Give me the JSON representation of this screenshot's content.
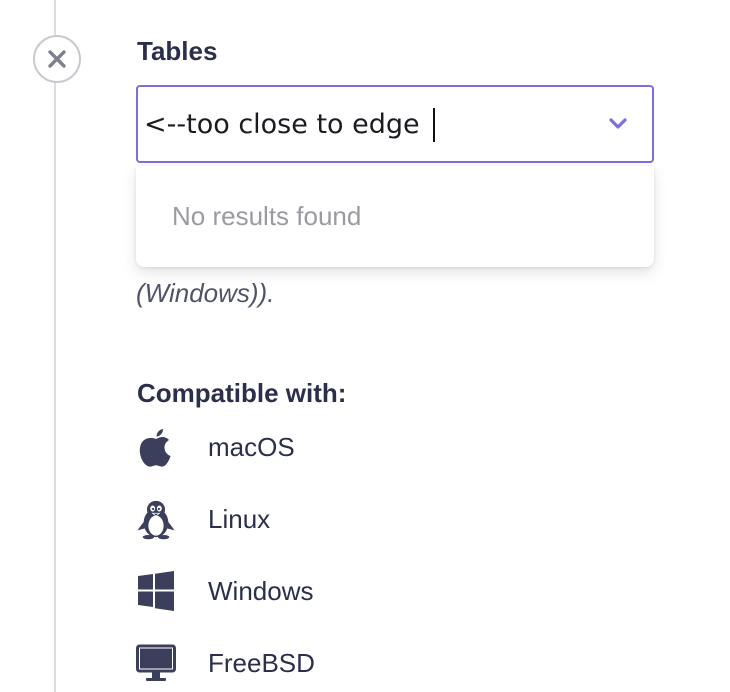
{
  "tables_field": {
    "label": "Tables",
    "value": "<--too close to edge",
    "no_results_text": "No results found"
  },
  "description_tail": "(Windows)).",
  "compatibility": {
    "heading": "Compatible with:",
    "items": [
      {
        "icon": "apple-icon",
        "label": "macOS"
      },
      {
        "icon": "linux-penguin-icon",
        "label": "Linux"
      },
      {
        "icon": "windows-icon",
        "label": "Windows"
      },
      {
        "icon": "monitor-icon",
        "label": "FreeBSD"
      }
    ]
  },
  "colors": {
    "accent": "#7b6ee0",
    "text": "#2b2f4b",
    "muted": "#9a9aa2",
    "icon": "#3b3f5c"
  }
}
